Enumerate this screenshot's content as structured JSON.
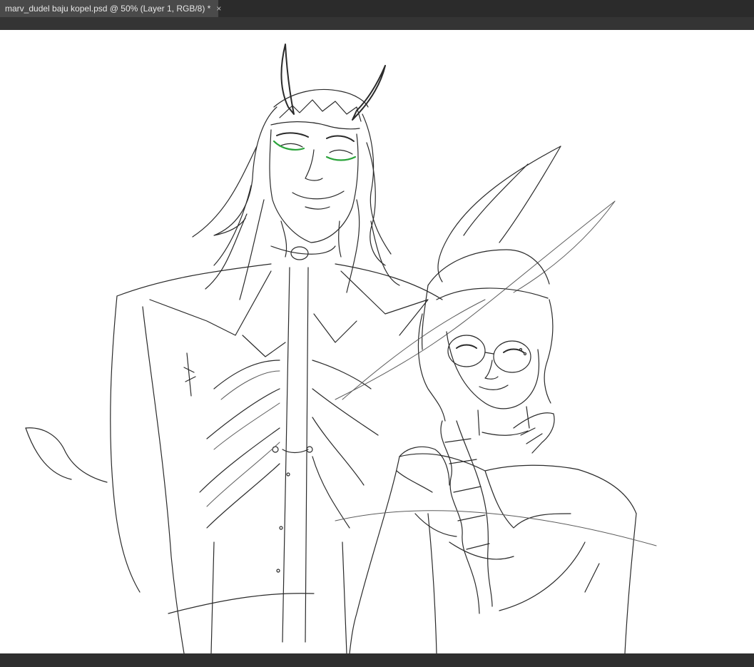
{
  "document_tab": {
    "title": "marv_dudel baju kopel.psd @ 50% (Layer 1, RGB/8) *",
    "close_glyph": "×"
  },
  "canvas": {
    "background_color": "#ffffff",
    "stroke_color": "#2a2a2a",
    "accent_color": "#2aa33a"
  },
  "colors": {
    "tab_active": "#4a4a4a",
    "tabbar": "#2b2b2b",
    "workspace": "#282828"
  }
}
